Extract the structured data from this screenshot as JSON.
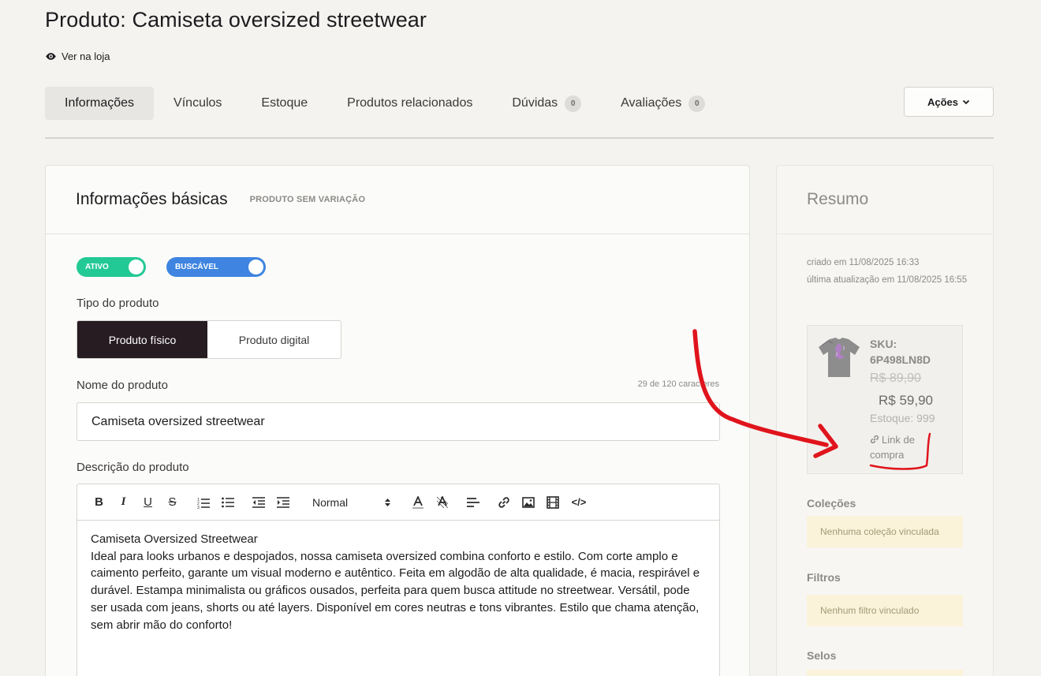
{
  "page": {
    "title": "Produto: Camiseta oversized streetwear",
    "store_link": "Ver na loja"
  },
  "tabs": [
    {
      "label": "Informações",
      "active": true
    },
    {
      "label": "Vínculos"
    },
    {
      "label": "Estoque"
    },
    {
      "label": "Produtos relacionados"
    },
    {
      "label": "Dúvidas",
      "badge": "0"
    },
    {
      "label": "Avaliações",
      "badge": "0"
    }
  ],
  "actions_label": "Ações",
  "basic": {
    "title": "Informações básicas",
    "subtitle": "PRODUTO SEM VARIAÇÃO",
    "toggle_active": "ATIVO",
    "toggle_searchable": "BUSCÁVEL",
    "type_label": "Tipo do produto",
    "type_physical": "Produto físico",
    "type_digital": "Produto digital",
    "name_label": "Nome do produto",
    "name_count": "29 de 120 caracteres",
    "name_value": "Camiseta oversized streetwear",
    "desc_label": "Descrição do produto",
    "format_select": "Normal",
    "desc_title": "Camiseta Oversized Streetwear",
    "desc_body": "Ideal para looks urbanos e despojados, nossa camiseta oversized combina conforto e estilo. Com corte amplo e caimento perfeito, garante um visual moderno e autêntico. Feita em algodão de alta qualidade, é macia, respirável e durável. Estampa minimalista ou gráficos ousados, perfeita para quem busca attitude no streetwear. Versátil, pode ser usada com jeans, shorts ou até layers. Disponível em cores neutras e tons vibrantes. Estilo que chama atenção, sem abrir mão do conforto!"
  },
  "summary": {
    "title": "Resumo",
    "created": "criado em 11/08/2025 16:33",
    "updated": "última atualização em 11/08/2025 16:55",
    "sku_label": "SKU:",
    "sku_value": "6P498LN8D",
    "old_price": "R$ 89,90",
    "new_price": "R$ 59,90",
    "stock": "Estoque: 999",
    "buy_link": "Link de compra",
    "collections_title": "Coleções",
    "collections_empty": "Nenhuma coleção vinculada",
    "filters_title": "Filtros",
    "filters_empty": "Nenhum filtro vinculado",
    "seals_title": "Selos"
  },
  "colors": {
    "active_toggle": "#23c995",
    "search_toggle": "#3e84e0",
    "annotation": "#e0141c",
    "physical_selected": "#261c22"
  }
}
